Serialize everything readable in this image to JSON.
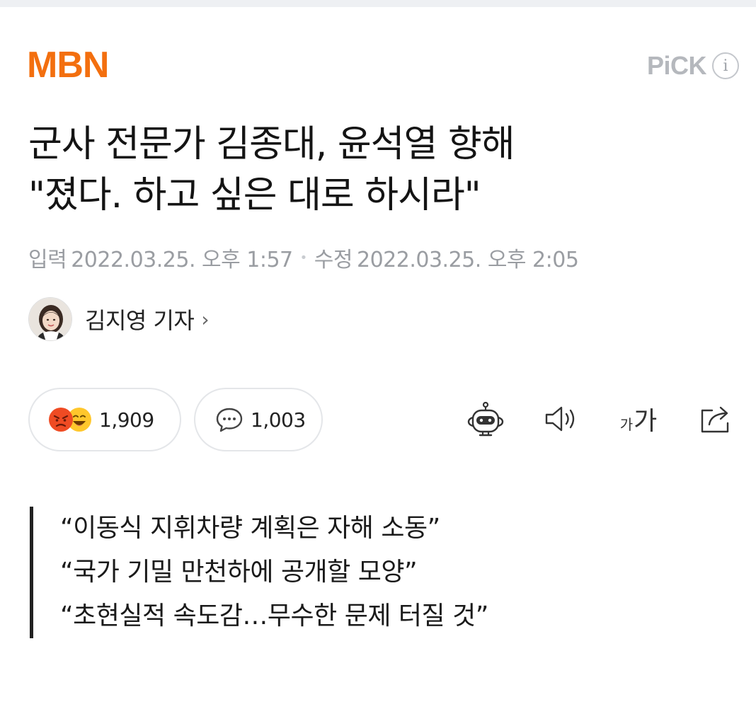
{
  "header": {
    "brand": "MBN",
    "pick_label": "PiCK",
    "info_glyph": "i",
    "accent_color": "#f36f0f"
  },
  "article": {
    "title_lines": [
      "군사 전문가 김종대, 윤석열 향해",
      "\"졌다. 하고 싶은 대로 하시라\""
    ],
    "input_label": "입력",
    "input_time": "2022.03.25. 오후 1:57",
    "edit_label": "수정",
    "edit_time": "2022.03.25. 오후 2:05",
    "reporter": "김지영 기자",
    "reporter_chevron": "›"
  },
  "actions": {
    "reaction_count": "1,909",
    "comment_count": "1,003",
    "font_size_small": "가",
    "font_size_large": "가",
    "icons": [
      "angry-face-icon",
      "laughing-face-icon",
      "comment-bubble-icon",
      "robot-summary-icon",
      "speaker-icon",
      "share-icon"
    ]
  },
  "summary": {
    "lines": [
      "“이동식 지휘차량 계획은 자해 소동”",
      "“국가 기밀 만천하에 공개할 모양”",
      "“초현실적 속도감…무수한 문제 터질 것”"
    ]
  }
}
